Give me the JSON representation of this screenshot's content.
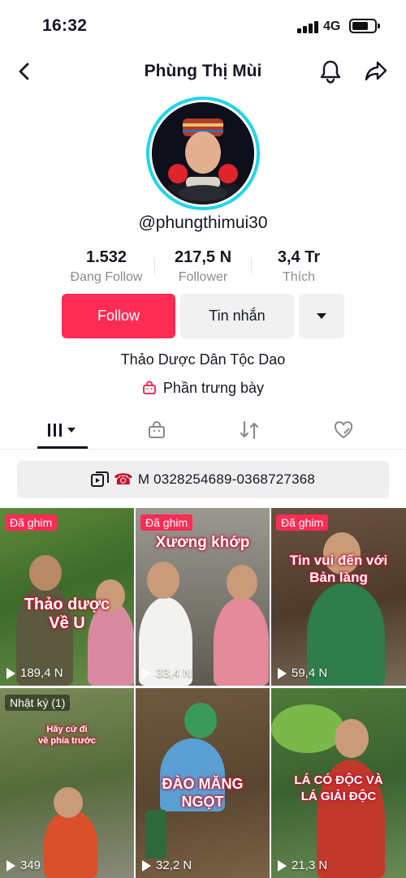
{
  "status_bar": {
    "time": "16:32",
    "network": "4G"
  },
  "header": {
    "title": "Phùng Thị Mùi"
  },
  "profile": {
    "username": "@phungthimui30",
    "bio": "Thảo Dược Dân Tộc Dao",
    "showcase_label": "Phần trưng bày"
  },
  "stats": [
    {
      "value": "1.532",
      "label": "Đang Follow"
    },
    {
      "value": "217,5 N",
      "label": "Follower"
    },
    {
      "value": "3,4 Tr",
      "label": "Thích"
    }
  ],
  "actions": {
    "follow": "Follow",
    "message": "Tin nhắn"
  },
  "contact": {
    "text": "M 0328254689-0368727368"
  },
  "videos": [
    {
      "badge": "Đã ghim",
      "caption": "Thảo dược\nVề U",
      "views": "189,4 N"
    },
    {
      "badge": "Đã ghim",
      "caption": "Xương khớp",
      "views": "33,4 N"
    },
    {
      "badge": "Đã ghim",
      "caption": "Tin vui đến với\nBản làng",
      "views": "59,4 N"
    },
    {
      "badge": "Nhật ký (1)",
      "caption": "Hãy cứ đi\nvề phía trước",
      "views": "349"
    },
    {
      "badge": "",
      "caption": "ĐÀO MĂNG\nNGỌT",
      "views": "32,2 N"
    },
    {
      "badge": "",
      "caption": "LÁ CÓ ĐỘC VÀ\nLÁ GIẢI ĐỘC",
      "views": "21,3 N"
    }
  ],
  "colors": {
    "accent": "#fe2c55",
    "avatar_ring": "#20d5ec"
  }
}
